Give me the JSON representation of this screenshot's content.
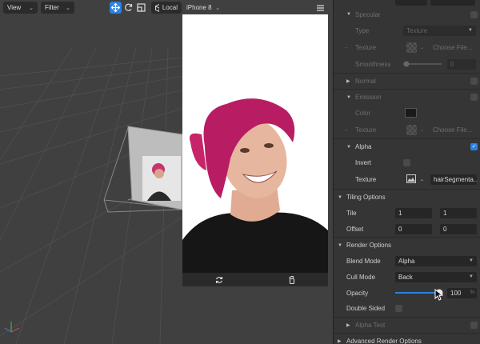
{
  "toolbar": {
    "view_label": "View",
    "filter_label": "Filter",
    "space_label": "Local",
    "device_label": "iPhone 8"
  },
  "inspector": {
    "specular": {
      "label": "Specular",
      "type_label": "Type",
      "type_value": "Texture",
      "texture_label": "Texture",
      "texture_value": "Choose File...",
      "smoothness_label": "Smoothness",
      "smoothness_value": "0"
    },
    "normal": {
      "label": "Normal"
    },
    "emission": {
      "label": "Emission",
      "color_label": "Color",
      "texture_label": "Texture",
      "texture_value": "Choose File..."
    },
    "alpha": {
      "label": "Alpha",
      "invert_label": "Invert",
      "texture_label": "Texture",
      "texture_value": "hairSegmenta..."
    },
    "tiling": {
      "label": "Tiling Options",
      "tile_label": "Tile",
      "tile_x": "1",
      "tile_y": "1",
      "offset_label": "Offset",
      "offset_x": "0",
      "offset_y": "0"
    },
    "render": {
      "label": "Render Options",
      "blend_label": "Blend Mode",
      "blend_value": "Alpha",
      "cull_label": "Cull Mode",
      "cull_value": "Back",
      "opacity_label": "Opacity",
      "opacity_value": "100",
      "opacity_unit": "%",
      "opacity_level": 1.0,
      "double_sided_label": "Double Sided"
    },
    "alpha_test": {
      "label": "Alpha Test"
    },
    "advanced": {
      "label": "Advanced Render Options"
    }
  },
  "colors": {
    "accent": "#2a82e4",
    "panel": "#353535",
    "viewport": "#404040"
  }
}
